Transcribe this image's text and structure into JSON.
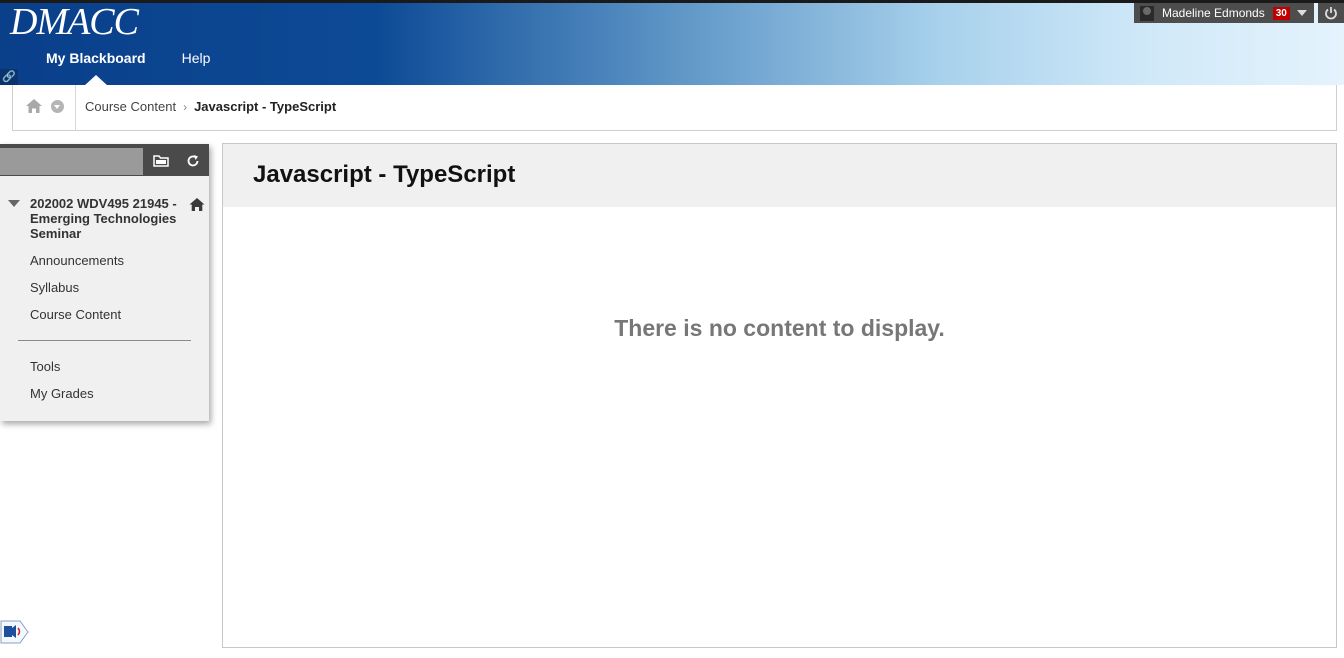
{
  "header": {
    "logo": "DMACC",
    "nav": [
      {
        "label": "My Blackboard",
        "active": true
      },
      {
        "label": "Help",
        "active": false
      }
    ],
    "user": {
      "name": "Madeline Edmonds",
      "notifications": "30"
    }
  },
  "breadcrumb": {
    "items": [
      "Course Content",
      "Javascript - TypeScript"
    ]
  },
  "sidebar": {
    "course_title": "202002 WDV495 21945 - Emerging Technologies Seminar",
    "menu": [
      "Announcements",
      "Syllabus",
      "Course Content"
    ],
    "tools": [
      "Tools",
      "My Grades"
    ]
  },
  "main": {
    "title": "Javascript - TypeScript",
    "empty_message": "There is no content to display."
  },
  "colors": {
    "header_dark": "#0a3f8a",
    "header_light": "#e4f3fc",
    "badge": "#c00000"
  }
}
